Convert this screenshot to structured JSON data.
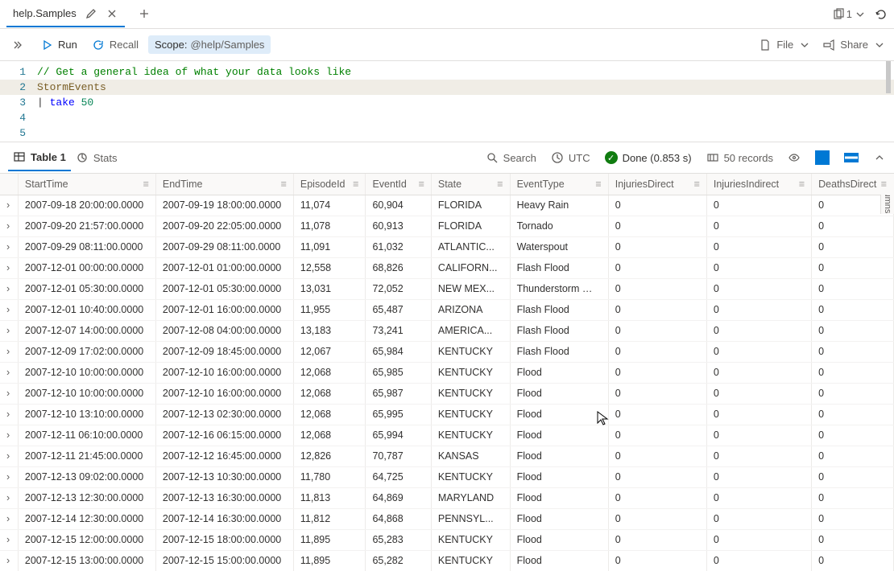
{
  "tabs": {
    "title": "help.Samples",
    "count": "1"
  },
  "toolbar": {
    "run": "Run",
    "recall": "Recall",
    "scope_label": "Scope:",
    "scope_value": "@help/Samples",
    "file": "File",
    "share": "Share"
  },
  "editor": {
    "lines": [
      {
        "n": "1",
        "type": "comment",
        "text": "// Get a general idea of what your data looks like"
      },
      {
        "n": "2",
        "type": "ident",
        "text": "StormEvents"
      },
      {
        "n": "3",
        "type": "pipe",
        "pipe": "| ",
        "op": "take ",
        "num": "50"
      },
      {
        "n": "4",
        "type": "blank",
        "text": ""
      },
      {
        "n": "5",
        "type": "blank",
        "text": ""
      }
    ]
  },
  "results_tabs": {
    "table": "Table 1",
    "stats": "Stats",
    "search": "Search",
    "utc": "UTC",
    "done": "Done (0.853 s)",
    "records": "50 records"
  },
  "columns": [
    "StartTime",
    "EndTime",
    "EpisodeId",
    "EventId",
    "State",
    "EventType",
    "InjuriesDirect",
    "InjuriesIndirect",
    "DeathsDirect"
  ],
  "columns_label": "Columns",
  "chart_data": {
    "type": "table",
    "columns": [
      "StartTime",
      "EndTime",
      "EpisodeId",
      "EventId",
      "State",
      "EventType",
      "InjuriesDirect",
      "InjuriesIndirect",
      "DeathsDirect"
    ],
    "rows": [
      [
        "2007-09-18 20:00:00.0000",
        "2007-09-19 18:00:00.0000",
        "11,074",
        "60,904",
        "FLORIDA",
        "Heavy Rain",
        "0",
        "0",
        "0"
      ],
      [
        "2007-09-20 21:57:00.0000",
        "2007-09-20 22:05:00.0000",
        "11,078",
        "60,913",
        "FLORIDA",
        "Tornado",
        "0",
        "0",
        "0"
      ],
      [
        "2007-09-29 08:11:00.0000",
        "2007-09-29 08:11:00.0000",
        "11,091",
        "61,032",
        "ATLANTIC...",
        "Waterspout",
        "0",
        "0",
        "0"
      ],
      [
        "2007-12-01 00:00:00.0000",
        "2007-12-01 01:00:00.0000",
        "12,558",
        "68,826",
        "CALIFORN...",
        "Flash Flood",
        "0",
        "0",
        "0"
      ],
      [
        "2007-12-01 05:30:00.0000",
        "2007-12-01 05:30:00.0000",
        "13,031",
        "72,052",
        "NEW MEX...",
        "Thunderstorm Wind",
        "0",
        "0",
        "0"
      ],
      [
        "2007-12-01 10:40:00.0000",
        "2007-12-01 16:00:00.0000",
        "11,955",
        "65,487",
        "ARIZONA",
        "Flash Flood",
        "0",
        "0",
        "0"
      ],
      [
        "2007-12-07 14:00:00.0000",
        "2007-12-08 04:00:00.0000",
        "13,183",
        "73,241",
        "AMERICA...",
        "Flash Flood",
        "0",
        "0",
        "0"
      ],
      [
        "2007-12-09 17:02:00.0000",
        "2007-12-09 18:45:00.0000",
        "12,067",
        "65,984",
        "KENTUCKY",
        "Flash Flood",
        "0",
        "0",
        "0"
      ],
      [
        "2007-12-10 10:00:00.0000",
        "2007-12-10 16:00:00.0000",
        "12,068",
        "65,985",
        "KENTUCKY",
        "Flood",
        "0",
        "0",
        "0"
      ],
      [
        "2007-12-10 10:00:00.0000",
        "2007-12-10 16:00:00.0000",
        "12,068",
        "65,987",
        "KENTUCKY",
        "Flood",
        "0",
        "0",
        "0"
      ],
      [
        "2007-12-10 13:10:00.0000",
        "2007-12-13 02:30:00.0000",
        "12,068",
        "65,995",
        "KENTUCKY",
        "Flood",
        "0",
        "0",
        "0"
      ],
      [
        "2007-12-11 06:10:00.0000",
        "2007-12-16 06:15:00.0000",
        "12,068",
        "65,994",
        "KENTUCKY",
        "Flood",
        "0",
        "0",
        "0"
      ],
      [
        "2007-12-11 21:45:00.0000",
        "2007-12-12 16:45:00.0000",
        "12,826",
        "70,787",
        "KANSAS",
        "Flood",
        "0",
        "0",
        "0"
      ],
      [
        "2007-12-13 09:02:00.0000",
        "2007-12-13 10:30:00.0000",
        "11,780",
        "64,725",
        "KENTUCKY",
        "Flood",
        "0",
        "0",
        "0"
      ],
      [
        "2007-12-13 12:30:00.0000",
        "2007-12-13 16:30:00.0000",
        "11,813",
        "64,869",
        "MARYLAND",
        "Flood",
        "0",
        "0",
        "0"
      ],
      [
        "2007-12-14 12:30:00.0000",
        "2007-12-14 16:30:00.0000",
        "11,812",
        "64,868",
        "PENNSYL...",
        "Flood",
        "0",
        "0",
        "0"
      ],
      [
        "2007-12-15 12:00:00.0000",
        "2007-12-15 18:00:00.0000",
        "11,895",
        "65,283",
        "KENTUCKY",
        "Flood",
        "0",
        "0",
        "0"
      ],
      [
        "2007-12-15 13:00:00.0000",
        "2007-12-15 15:00:00.0000",
        "11,895",
        "65,282",
        "KENTUCKY",
        "Flood",
        "0",
        "0",
        "0"
      ]
    ]
  }
}
